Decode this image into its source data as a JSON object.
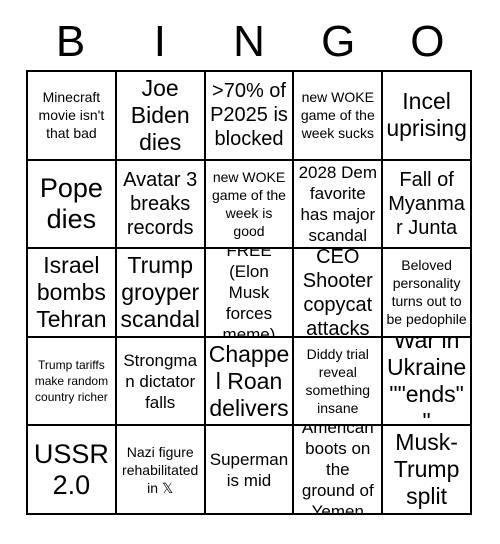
{
  "card": {
    "title": "BINGO",
    "header_letters": [
      "B",
      "I",
      "N",
      "G",
      "O"
    ],
    "grid_size": "5x5",
    "colors": {
      "background": "#ffffff",
      "border": "#000000",
      "text": "#000000"
    },
    "rows": [
      [
        {
          "text": "Minecraft movie isn't that bad",
          "size": "t-sm"
        },
        {
          "text": "Joe Biden dies",
          "size": "t-xl"
        },
        {
          "text": ">70% of P2025 is blocked",
          "size": "t-lg"
        },
        {
          "text": "new WOKE game of the week sucks",
          "size": "t-sm"
        },
        {
          "text": "Incel uprising",
          "size": "t-xl"
        }
      ],
      [
        {
          "text": "Pope dies",
          "size": "t-xxl"
        },
        {
          "text": "Avatar 3 breaks records",
          "size": "t-lg"
        },
        {
          "text": "new WOKE game of the week is good",
          "size": "t-sm"
        },
        {
          "text": "2028 Dem favorite has major scandal",
          "size": "t-md"
        },
        {
          "text": "Fall of Myanmar Junta",
          "size": "t-lg"
        }
      ],
      [
        {
          "text": "Israel bombs Tehran",
          "size": "t-xl"
        },
        {
          "text": "Trump groyper scandal",
          "size": "t-xl"
        },
        {
          "text": "FREE (Elon Musk forces meme)",
          "size": "t-md"
        },
        {
          "text": "CEO Shooter copycat attacks",
          "size": "t-lg"
        },
        {
          "text": "Beloved personality turns out to be pedophile",
          "size": "t-sm"
        }
      ],
      [
        {
          "text": "Trump tariffs make random country richer",
          "size": "t-xs"
        },
        {
          "text": "Strongman dictator falls",
          "size": "t-md"
        },
        {
          "text": "Chappel Roan delivers",
          "size": "t-xl"
        },
        {
          "text": "Diddy trial reveal something insane",
          "size": "t-sm"
        },
        {
          "text": "War in Ukraine \"\"ends\"\"",
          "size": "t-xl"
        }
      ],
      [
        {
          "text": "USSR 2.0",
          "size": "t-xxl"
        },
        {
          "text": "Nazi figure rehabilitated in 𝕏",
          "size": "t-sm"
        },
        {
          "text": "Superman is mid",
          "size": "t-md"
        },
        {
          "text": "American boots on the ground of Yemen",
          "size": "t-md"
        },
        {
          "text": "Musk-Trump split",
          "size": "t-xl"
        }
      ]
    ]
  }
}
